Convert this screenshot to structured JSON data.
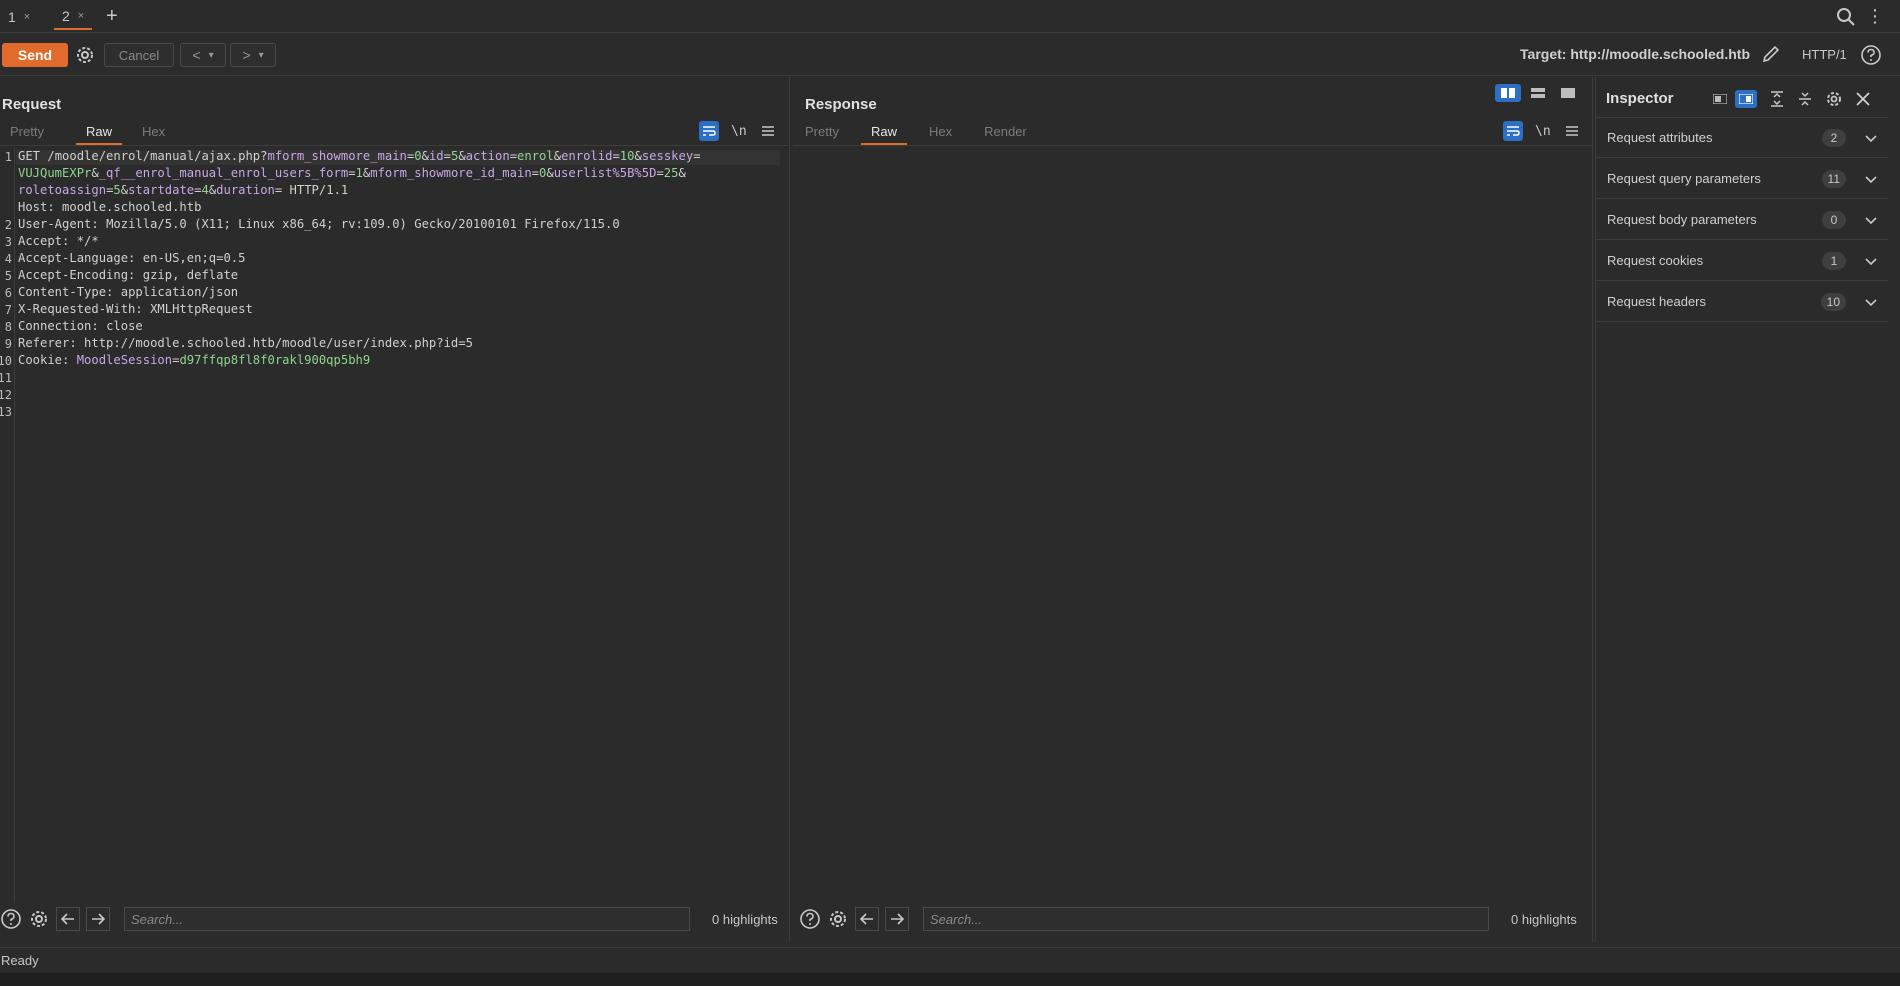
{
  "tabs": [
    {
      "label": "1",
      "close": "×",
      "active": false
    },
    {
      "label": "2",
      "close": "×",
      "active": true
    }
  ],
  "toolbar": {
    "send_label": "Send",
    "cancel_label": "Cancel",
    "back_label": "<",
    "forward_label": ">",
    "dropdown_label": "▾",
    "target_label": "Target: http://moodle.schooled.htb",
    "http_version": "HTTP/1"
  },
  "request": {
    "title": "Request",
    "tabs": [
      "Pretty",
      "Raw",
      "Hex"
    ],
    "active_tab": "Raw",
    "newline_label": "\\n",
    "line_numbers": [
      "1",
      "",
      "",
      "2",
      "3",
      "4",
      "5",
      "6",
      "7",
      "8",
      "9",
      "10",
      "11",
      "12",
      "13"
    ],
    "search_placeholder": "Search...",
    "highlights": "0 highlights"
  },
  "response": {
    "title": "Response",
    "tabs": [
      "Pretty",
      "Raw",
      "Hex",
      "Render"
    ],
    "active_tab": "Raw",
    "newline_label": "\\n",
    "search_placeholder": "Search...",
    "highlights": "0 highlights"
  },
  "inspector": {
    "title": "Inspector",
    "rows": [
      {
        "label": "Request attributes",
        "count": "2"
      },
      {
        "label": "Request query parameters",
        "count": "11"
      },
      {
        "label": "Request body parameters",
        "count": "0"
      },
      {
        "label": "Request cookies",
        "count": "1"
      },
      {
        "label": "Request headers",
        "count": "10"
      }
    ]
  },
  "status": "Ready",
  "colors": {
    "accent": "#e06b2d",
    "wrap_active": "#2d6fc4",
    "param_name": "#c9a6e8",
    "param_value": "#8fd48f"
  }
}
